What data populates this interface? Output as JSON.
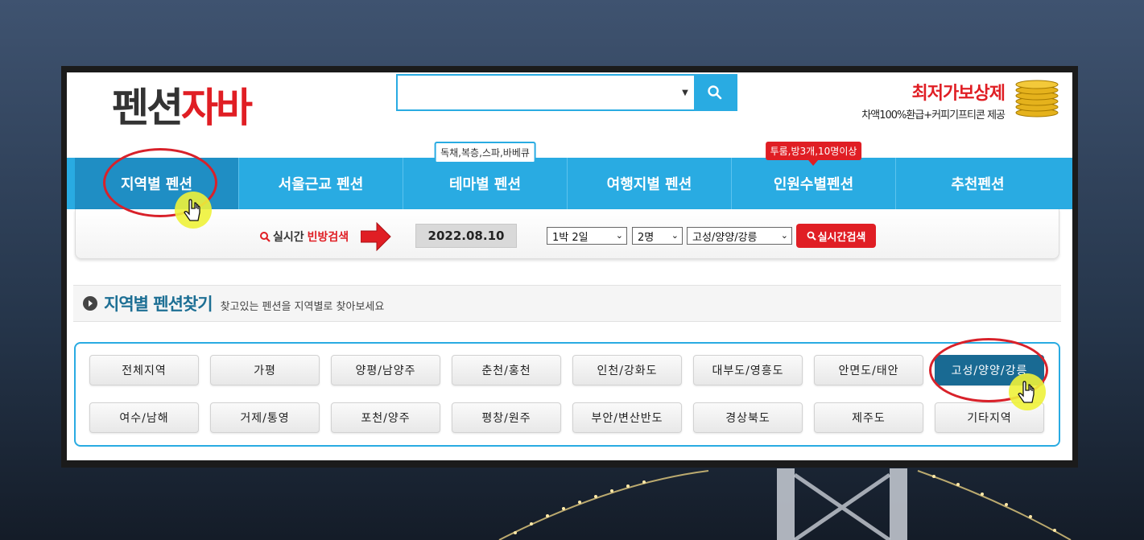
{
  "header": {
    "logo_part1": "펜션",
    "logo_part2": "자바",
    "search_value": "",
    "promo_title": "최저가보상제",
    "promo_sub": "차액100%환급+커피기프티콘 제공"
  },
  "nav": {
    "items": [
      {
        "label": "지역별 펜션"
      },
      {
        "label": "서울근교 펜션"
      },
      {
        "label": "테마별 펜션",
        "tip": "독채,복층,스파,바베큐"
      },
      {
        "label": "여행지별 펜션"
      },
      {
        "label": "인원수별펜션",
        "tip": "투룸,방3개,10명이상"
      },
      {
        "label": "추천펜션"
      }
    ]
  },
  "realtime": {
    "label_prefix": "실시간",
    "label_highlight": "빈방검색",
    "date": "2022.08.10",
    "stay": "1박 2일",
    "people": "2명",
    "region": "고성/양양/강릉",
    "button": "실시간검색"
  },
  "section": {
    "title": "지역별 펜션찾기",
    "subtitle": "찾고있는 펜션을 지역별로 찾아보세요"
  },
  "regions": {
    "row1": [
      "전체지역",
      "가평",
      "양평/남양주",
      "춘천/홍천",
      "인천/강화도",
      "대부도/영흥도",
      "안면도/태안",
      "고성/양양/강릉"
    ],
    "row2": [
      "여수/남해",
      "거제/통영",
      "포천/양주",
      "평창/원주",
      "부안/변산반도",
      "경상북도",
      "제주도",
      "기타지역"
    ],
    "selected": "고성/양양/강릉"
  },
  "colors": {
    "brand_blue": "#29abe2",
    "brand_red": "#e01e24",
    "active_region": "#196a93"
  }
}
